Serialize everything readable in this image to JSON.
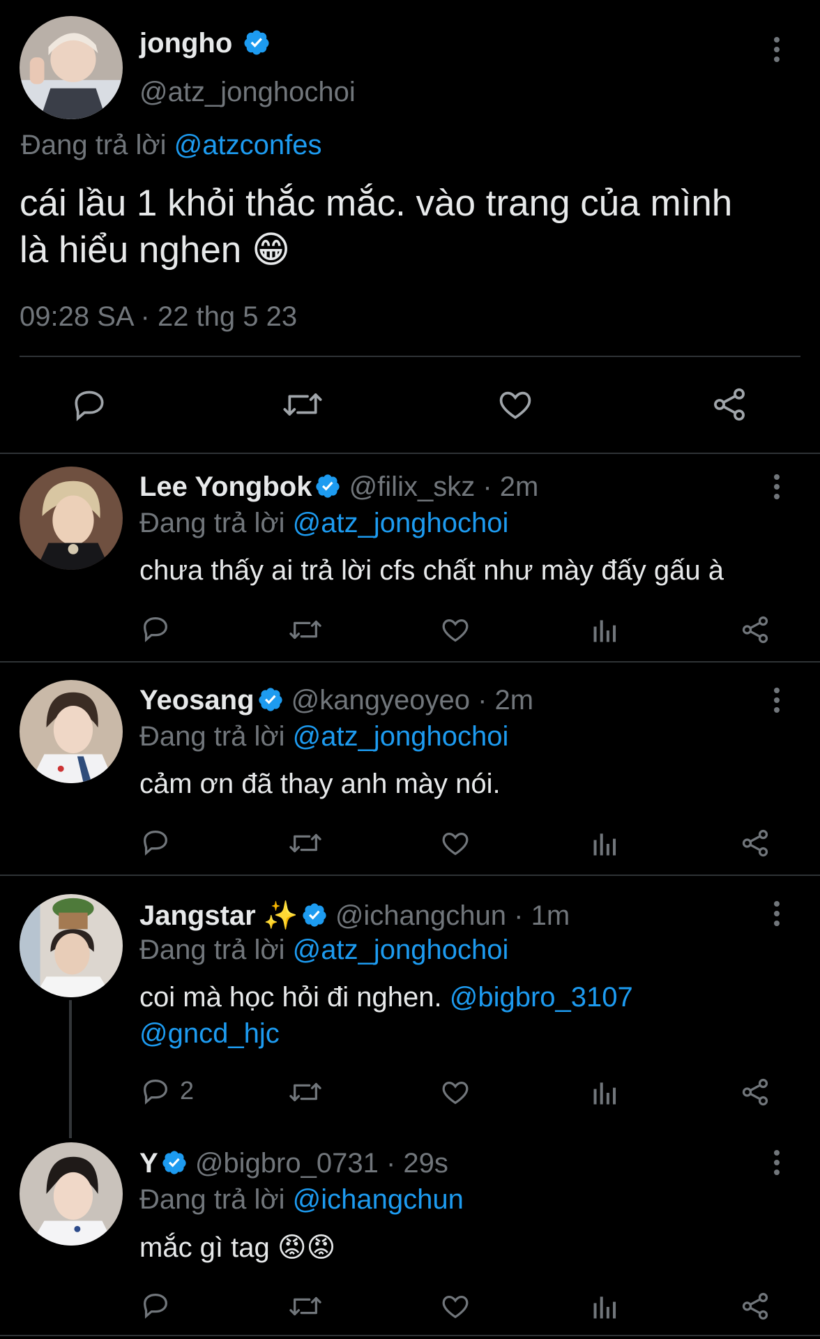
{
  "main_tweet": {
    "display_name": "jongho",
    "handle": "@atz_jonghochoi",
    "reply_prefix": "Đang trả lời",
    "reply_to": "@atzconfes",
    "text_line1": "cái lầu 1 khỏi thắc mắc. vào trang của mình",
    "text_line2": "là hiểu nghen",
    "emoji": "😁",
    "time": "09:28 SA",
    "date": "22 thg 5 23"
  },
  "replies": [
    {
      "display_name": "Lee Yongbok",
      "handle": "@filix_skz",
      "age": "2m",
      "reply_prefix": "Đang trả lời",
      "reply_to": "@atz_jonghochoi",
      "text": "chưa thấy ai trả lời cfs chất như mày đấy gấu à"
    },
    {
      "display_name": "Yeosang",
      "handle": "@kangyeoyeo",
      "age": "2m",
      "reply_prefix": "Đang trả lời",
      "reply_to": "@atz_jonghochoi",
      "text": "cảm ơn đã thay anh mày nói."
    },
    {
      "display_name": "Jangstar",
      "name_emoji": "✨",
      "handle": "@ichangchun",
      "age": "1m",
      "reply_prefix": "Đang trả lời",
      "reply_to": "@atz_jonghochoi",
      "text": "coi mà học hỏi đi nghen.",
      "mention1": "@bigbro_3107",
      "mention2": "@gncd_hjc",
      "reply_count": "2"
    },
    {
      "display_name": "Y",
      "handle": "@bigbro_0731",
      "age": "29s",
      "reply_prefix": "Đang trả lời",
      "reply_to": "@ichangchun",
      "text": "mắc gì tag",
      "emoji": "😡😡"
    }
  ],
  "separator": "·",
  "colors": {
    "background": "#000000",
    "text": "#e7e9ea",
    "secondary": "#71767b",
    "link": "#1d9bf0",
    "divider": "#2f3336"
  },
  "icons": [
    "verified-badge-icon",
    "more-icon",
    "reply-icon",
    "retweet-icon",
    "like-icon",
    "views-icon",
    "share-icon"
  ]
}
